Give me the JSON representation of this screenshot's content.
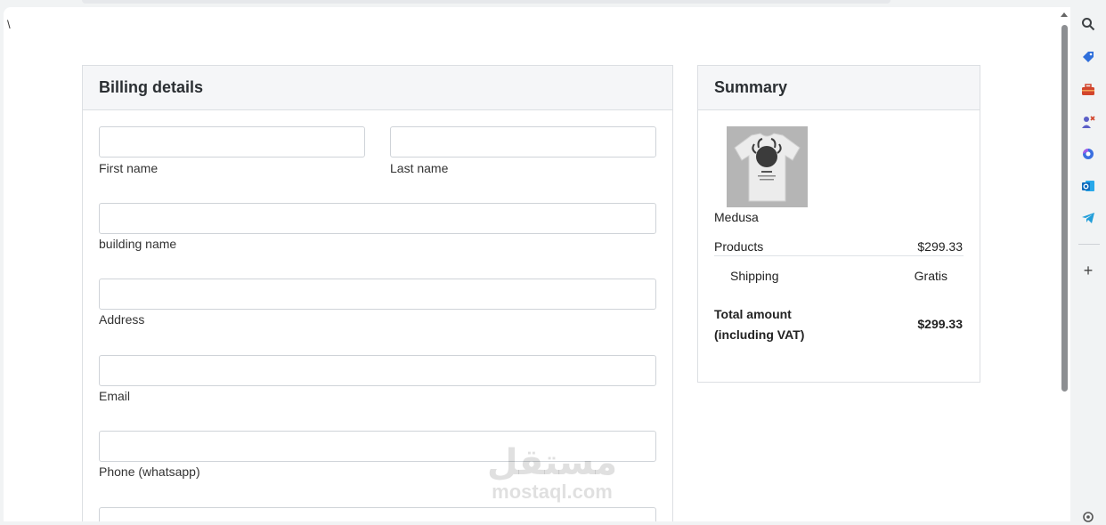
{
  "page": {
    "stray_text": "\\"
  },
  "billing": {
    "title": "Billing details",
    "fields": [
      {
        "label": "First name",
        "value": ""
      },
      {
        "label": "Last name",
        "value": ""
      },
      {
        "label": "building name",
        "value": ""
      },
      {
        "label": "Address",
        "value": ""
      },
      {
        "label": "Email",
        "value": ""
      },
      {
        "label": "Phone (whatsapp)",
        "value": ""
      }
    ]
  },
  "summary": {
    "title": "Summary",
    "product_name": "Medusa",
    "products_label": "Products",
    "products_value": "$299.33",
    "shipping_label": "Shipping",
    "shipping_value": "Gratis",
    "total_label_line1": "Total amount",
    "total_label_line2": "(including VAT)",
    "total_value": "$299.33"
  },
  "watermark": {
    "arabic": "مستقل",
    "latin": "mostaql.com"
  },
  "sidebar": {
    "icons": [
      "search-icon",
      "tag-icon",
      "toolbox-icon",
      "people-icon",
      "copilot-icon",
      "outlook-icon",
      "telegram-icon",
      "plus-icon",
      "settings-icon"
    ],
    "colors": {
      "search": "#3c4043",
      "tag": "#2f6fdb",
      "toolbox": "#d2452c",
      "people": "#5b5fc7",
      "outlook": "#0f6cbd",
      "telegram": "#229ed9"
    }
  }
}
